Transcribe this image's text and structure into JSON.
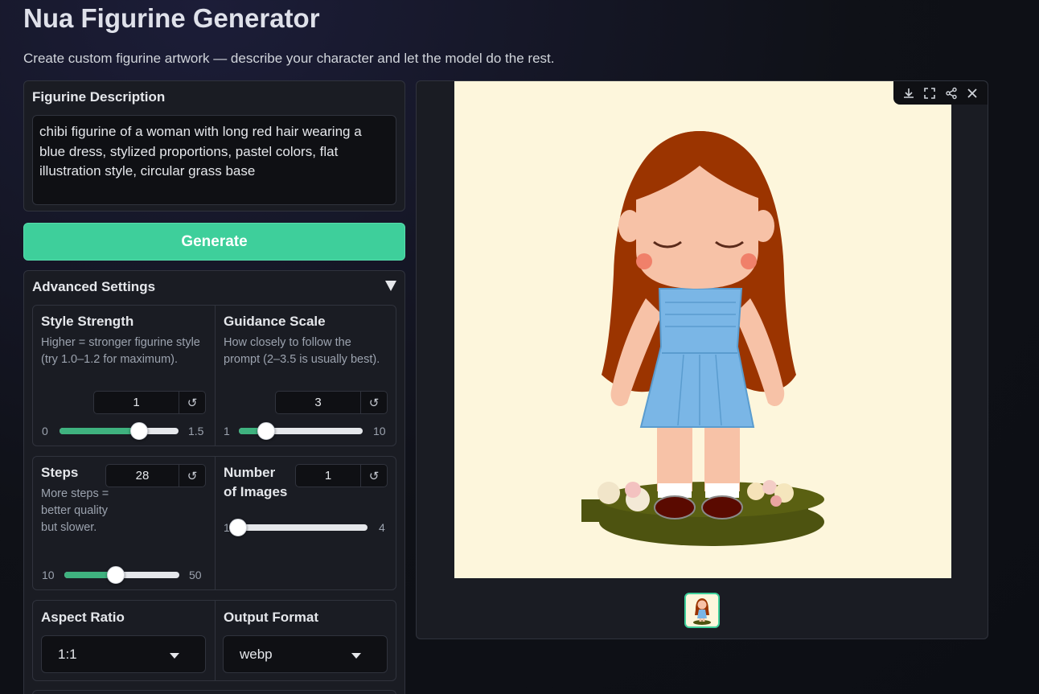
{
  "header": {
    "title": "Nua Figurine Generator",
    "subtitle": "Create custom figurine artwork — describe your character and let the model do the rest."
  },
  "description": {
    "label": "Figurine Description",
    "value": "chibi figurine of a woman with long red hair wearing a blue dress, stylized proportions, pastel colors, flat illustration style, circular grass base"
  },
  "generate_label": "Generate",
  "advanced": {
    "label": "Advanced Settings",
    "style_strength": {
      "title": "Style Strength",
      "info": "Higher = stronger figurine style (try 1.0–1.2 for maximum).",
      "value": "1",
      "min": "0",
      "max": "1.5",
      "fraction": 0.667
    },
    "guidance_scale": {
      "title": "Guidance Scale",
      "info": "How closely to follow the prompt (2–3.5 is usually best).",
      "value": "3",
      "min": "1",
      "max": "10",
      "fraction": 0.222
    },
    "steps": {
      "title": "Steps",
      "info": "More steps = better quality but slower.",
      "value": "28",
      "min": "10",
      "max": "50",
      "fraction": 0.45
    },
    "num_images": {
      "title_line1": "Number",
      "title_line2": "of Images",
      "value": "1",
      "min": "1",
      "max": "4",
      "fraction": 0.0
    },
    "aspect_ratio": {
      "title": "Aspect Ratio",
      "value": "1:1"
    },
    "output_format": {
      "title": "Output Format",
      "value": "webp"
    }
  },
  "colors": {
    "accent": "#3ecf9b",
    "slider_fill": "#3fb27f",
    "background": "#0f1117"
  },
  "gallery_tools": [
    "download-icon",
    "fullscreen-icon",
    "share-icon",
    "close-icon"
  ]
}
